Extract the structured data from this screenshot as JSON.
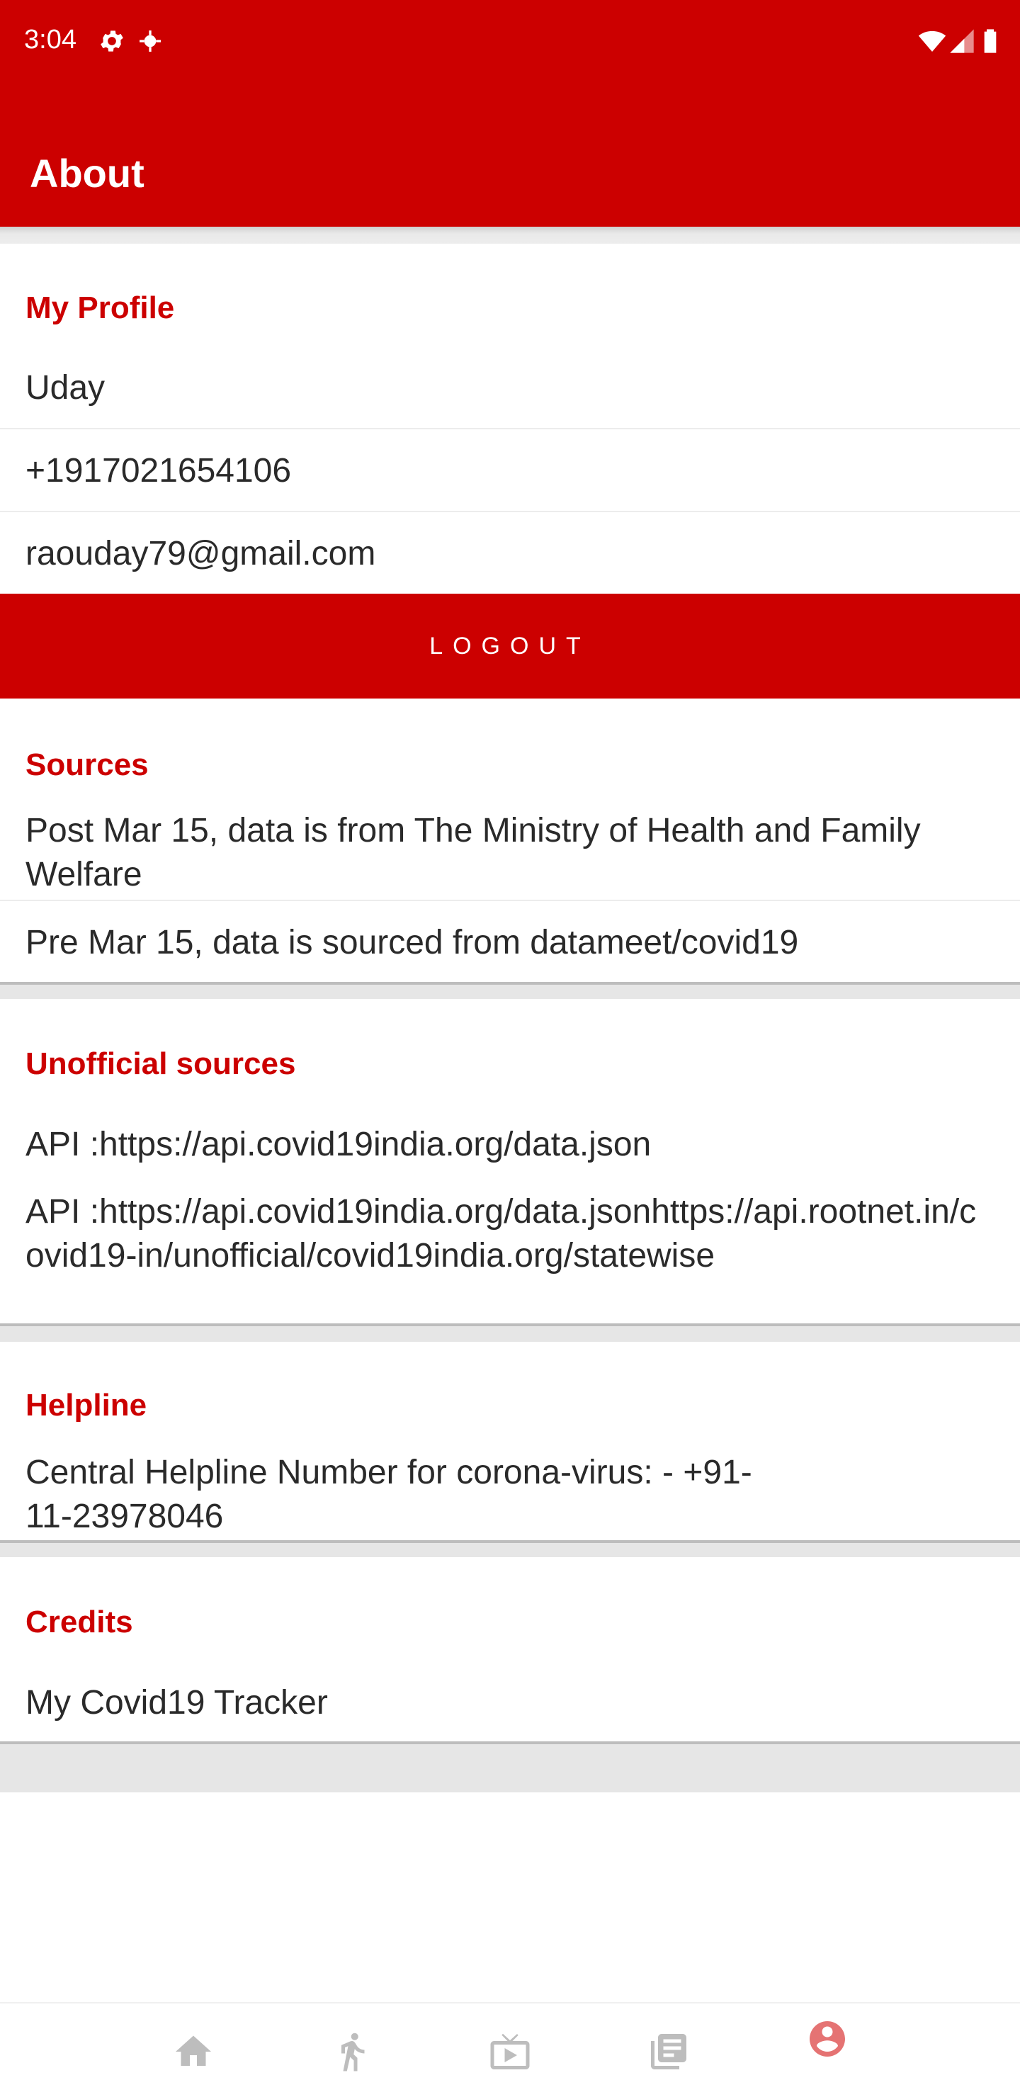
{
  "status_bar": {
    "time": "3:04"
  },
  "app_bar": {
    "title": "About"
  },
  "profile": {
    "header": "My Profile",
    "name": "Uday",
    "phone": "+1917021654106",
    "email": "raouday79@gmail.com",
    "logout_label": "LOGOUT"
  },
  "sources": {
    "header": "Sources",
    "items": [
      "Post Mar 15, data is from The Ministry of Health and Family Welfare",
      "Pre Mar 15, data is sourced from datameet/covid19"
    ]
  },
  "unofficial_sources": {
    "header": "Unofficial sources",
    "items": [
      "API :https://api.covid19india.org/data.json",
      "API :https://api.covid19india.org/data.jsonhttps://api.rootnet.in/covid19-in/unofficial/covid19india.org/statewise"
    ]
  },
  "helpline": {
    "header": "Helpline",
    "text": "Central Helpline Number for corona-virus: - +91-11-23978046"
  },
  "credits": {
    "header": "Credits",
    "text": "My Covid19 Tracker"
  },
  "bottom_nav": {
    "items": [
      {
        "icon": "home-icon",
        "selected": false
      },
      {
        "icon": "walking-person-icon",
        "selected": false
      },
      {
        "icon": "live-tv-icon",
        "selected": false
      },
      {
        "icon": "news-library-icon",
        "selected": false
      },
      {
        "icon": "account-circle-icon",
        "selected": true
      }
    ],
    "colors": {
      "selected": "#e57373",
      "unselected": "#bdbdbd"
    }
  },
  "colors": {
    "accent": "#cc0000",
    "text": "#2a2a2a",
    "band": "#e6e6e6"
  }
}
